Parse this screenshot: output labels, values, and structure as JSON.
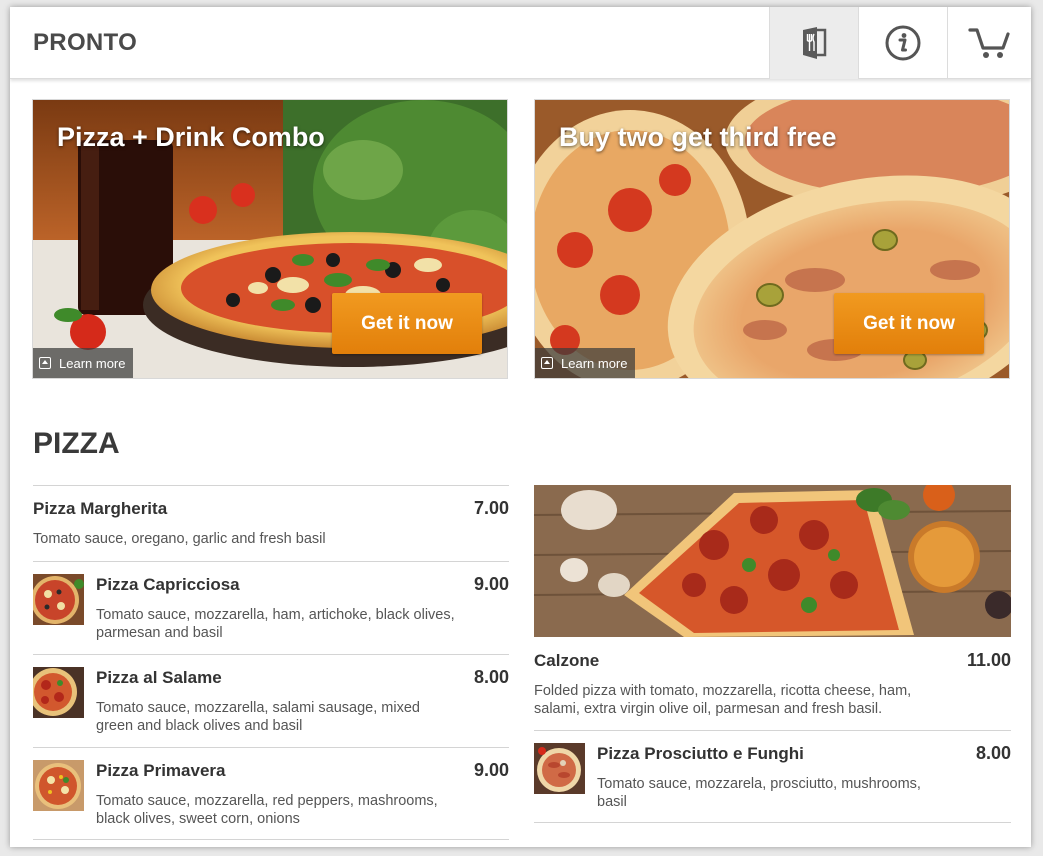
{
  "app": {
    "brand": "PRONTO",
    "nav": [
      {
        "icon": "menu-book-icon",
        "active": true
      },
      {
        "icon": "info-icon",
        "active": false
      },
      {
        "icon": "cart-icon",
        "active": false
      }
    ]
  },
  "promos": [
    {
      "title": "Pizza + Drink Combo",
      "cta": "Get it now",
      "learn_more": "Learn more"
    },
    {
      "title": "Buy two get third free",
      "cta": "Get it now",
      "learn_more": "Learn more"
    }
  ],
  "section": {
    "title": "PIZZA"
  },
  "menu_left": [
    {
      "name": "Pizza Margherita",
      "price": "7.00",
      "description": "Tomato sauce, oregano, garlic and fresh basil",
      "has_thumb": false
    },
    {
      "name": "Pizza Capricciosa",
      "price": "9.00",
      "description": "Tomato sauce, mozzarella, ham, artichoke, black olives, parmesan and basil",
      "has_thumb": true
    },
    {
      "name": "Pizza al Salame",
      "price": "8.00",
      "description": "Tomato sauce, mozzarella, salami sausage, mixed green and black olives and basil",
      "has_thumb": true
    },
    {
      "name": "Pizza Primavera",
      "price": "9.00",
      "description": "Tomato sauce, mozzarella, red peppers, mashrooms, black olives, sweet corn, onions",
      "has_thumb": true
    }
  ],
  "menu_right": [
    {
      "name": "Calzone",
      "price": "11.00",
      "description": "Folded pizza with tomato, mozzarella, ricotta cheese, ham, salami, extra virgin olive oil, parmesan and fresh basil.",
      "has_thumb": false
    },
    {
      "name": "Pizza Prosciutto e Funghi",
      "price": "8.00",
      "description": "Tomato sauce, mozzarela, prosciutto, mushrooms, basil",
      "has_thumb": true
    }
  ],
  "colors": {
    "accent": "#e8870f",
    "text": "#333333",
    "divider": "#d4d4d4"
  }
}
